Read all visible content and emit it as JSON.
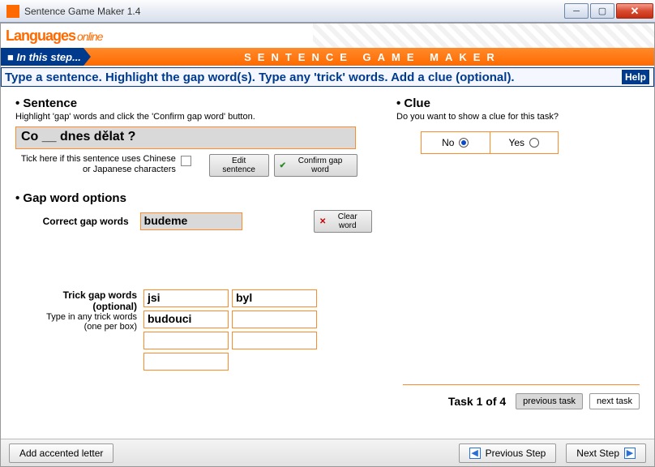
{
  "window": {
    "title": "Sentence Game Maker 1.4"
  },
  "logo": {
    "brand1": "La",
    "brand2": "nguages",
    "script": "online"
  },
  "banner": {
    "step_label": "■ In this step...",
    "maker_label": "SENTENCE  GAME  MAKER"
  },
  "instructions": "Type a sentence. Highlight the gap word(s). Type any 'trick' words.  Add a clue (optional).",
  "help_label": "Help",
  "sentence": {
    "heading": "Sentence",
    "sub": "Highlight 'gap' words and click the 'Confirm gap word' button.",
    "text": "Co __ dnes dělat ?",
    "cjk_label": "Tick here if this sentence uses Chinese or Japanese characters",
    "edit_btn": "Edit sentence",
    "confirm_btn": "Confirm gap word"
  },
  "gap": {
    "heading": "Gap word options",
    "correct_label": "Correct gap words",
    "correct_value": "budeme",
    "clear_btn": "Clear word"
  },
  "trick": {
    "label1": "Trick gap words",
    "label2": "(optional)",
    "sub1": "Type in any trick words",
    "sub2": "(one per box)",
    "words": [
      "jsi",
      "byl",
      "budouci",
      "",
      "",
      "",
      "",
      ""
    ]
  },
  "clue": {
    "heading": "Clue",
    "sub": "Do you want to show a clue for this task?",
    "no": "No",
    "yes": "Yes",
    "selected": "no"
  },
  "tasks": {
    "label": "Task 1 of 4",
    "prev": "previous task",
    "next": "next task"
  },
  "footer": {
    "accent": "Add accented letter",
    "prev": "Previous Step",
    "next": "Next Step"
  }
}
